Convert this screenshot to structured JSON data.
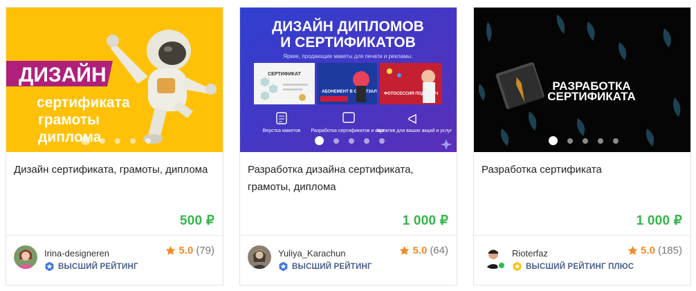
{
  "cards": [
    {
      "cover": {
        "line1": "ДИЗАЙН",
        "line2": "сертификата",
        "line3": "грамоты",
        "line4": "диплома"
      },
      "title": "Дизайн сертификата, грамоты, диплома",
      "price": "500 ₽",
      "seller": {
        "name": "Irina-designeren",
        "badge": "ВЫСШИЙ РЕЙТИНГ"
      },
      "rating": {
        "value": "5.0",
        "count": "(79)"
      }
    },
    {
      "cover": {
        "heading1": "ДИЗАЙН ДИПЛОМОВ",
        "heading2": "И СЕРТИФИКАТОВ",
        "subheading": "Яркие, продающие макеты для печати и рекламы.",
        "preview1_title": "СЕРТИФИКАТ",
        "preview2_title": "АБОНЕМЕНТ В СПОРТЗАЛ",
        "preview3_title": "ФОТОСЕССИЯ ПОД КЛЮЧ",
        "feature1": "Верстка макетов",
        "feature2": "Разработка сертификатов и карт",
        "feature3": "Креатив для ваших акций и услуг"
      },
      "title": "Разработка дизайна сертификата, грамоты, диплома",
      "price": "1 000 ₽",
      "seller": {
        "name": "Yuliya_Karachun",
        "badge": "ВЫСШИЙ РЕЙТИНГ"
      },
      "rating": {
        "value": "5.0",
        "count": "(64)"
      }
    },
    {
      "cover": {
        "line1": "РАЗРАБОТКА",
        "line2": "СЕРТИФИКАТА"
      },
      "title": "Разработка сертификата",
      "price": "1 000 ₽",
      "seller": {
        "name": "Rioterfaz",
        "badge": "ВЫСШИЙ РЕЙТИНГ ПЛЮС"
      },
      "rating": {
        "value": "5.0",
        "count": "(185)"
      }
    }
  ],
  "colors": {
    "price": "#35b54c",
    "rating": "#f38a2a",
    "badge_text": "#4a5f8e",
    "cover1_bg": "#ffc107",
    "cover2_bg": "#3d3fc4",
    "cover3_bg": "#050505"
  },
  "icons": {
    "badge_top": "blue-star-shield-icon",
    "badge_top_plus": "gold-star-shield-icon",
    "rating": "star-icon"
  }
}
